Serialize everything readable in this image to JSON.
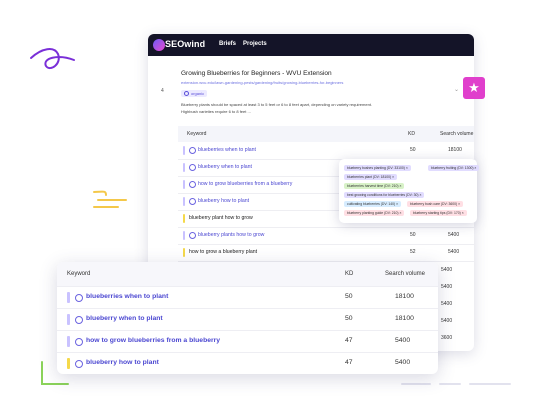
{
  "app": {
    "logo": "SEOwind",
    "nav": [
      "Briefs",
      "Projects"
    ]
  },
  "result": {
    "number": "4",
    "title": "Growing Blueberries for Beginners - WVU Extension",
    "url": "extension.wvu.edu/lawn-gardening-pests/gardening/fruits/growing-blueberries-for-beginners",
    "tag": "organic",
    "snippet_1": "Blueberry plants should be spaced at least 3 to 5 feet or 6 to 8 feet apart, depending on variety requirement.",
    "snippet_2": "Highbush varieties require 6 to 8 feet ..."
  },
  "back_table": {
    "headers": [
      "Keyword",
      "KD",
      "Search volume"
    ],
    "rows": [
      {
        "keyword": "blueberries when to plant",
        "kd": "50",
        "volume": "18100"
      },
      {
        "keyword": "blueberry when to plant",
        "kd": "",
        "volume": ""
      },
      {
        "keyword": "how to grow blueberries from a blueberry",
        "kd": "",
        "volume": ""
      },
      {
        "keyword": "blueberry how to plant",
        "kd": "",
        "volume": ""
      },
      {
        "keyword": "blueberry plant how to grow",
        "kd": "",
        "volume": ""
      },
      {
        "keyword": "blueberry plants how to grow",
        "kd": "50",
        "volume": "5400"
      },
      {
        "keyword": "how to grow a blueberry plant",
        "kd": "52",
        "volume": "5400"
      }
    ],
    "extra_volumes": [
      "5400",
      "5400",
      "5400",
      "5400",
      "3600"
    ]
  },
  "popup_chips": [
    {
      "label": "blueberry bushes planting (DV: 33100)",
      "color": "purple"
    },
    {
      "label": "blueberry fruiting (DV: 1300)",
      "color": "purple"
    },
    {
      "label": "blueberries plant (DV: 18100)",
      "color": "purple"
    },
    {
      "label": "blueberries harvest time (DV: 210)",
      "color": "green"
    },
    {
      "label": "best growing conditions for blueberries (DV: 30)",
      "color": "purple"
    },
    {
      "label": "cultivating blueberries (DV: 140)",
      "color": "blue"
    },
    {
      "label": "blueberry bush care (DV: 3600)",
      "color": "pink"
    },
    {
      "label": "blueberry planting guide (DV: 210)",
      "color": "pink"
    },
    {
      "label": "blueberry starting tips (DV: 170)",
      "color": "pink"
    }
  ],
  "front_table": {
    "headers": [
      "Keyword",
      "KD",
      "Search volume"
    ],
    "rows": [
      {
        "keyword": "blueberries when to plant",
        "kd": "50",
        "volume": "18100"
      },
      {
        "keyword": "blueberry when to plant",
        "kd": "50",
        "volume": "18100"
      },
      {
        "keyword": "how to grow blueberries from a blueberry",
        "kd": "47",
        "volume": "5400"
      },
      {
        "keyword": "blueberry how to plant",
        "kd": "47",
        "volume": "5400"
      }
    ]
  },
  "colors": {
    "nav_bg": "#141428",
    "accent": "#4b47d1",
    "badge": "#e03fcc"
  },
  "icons": {
    "star_badge": "star-icon",
    "check": "check-circle-icon"
  }
}
